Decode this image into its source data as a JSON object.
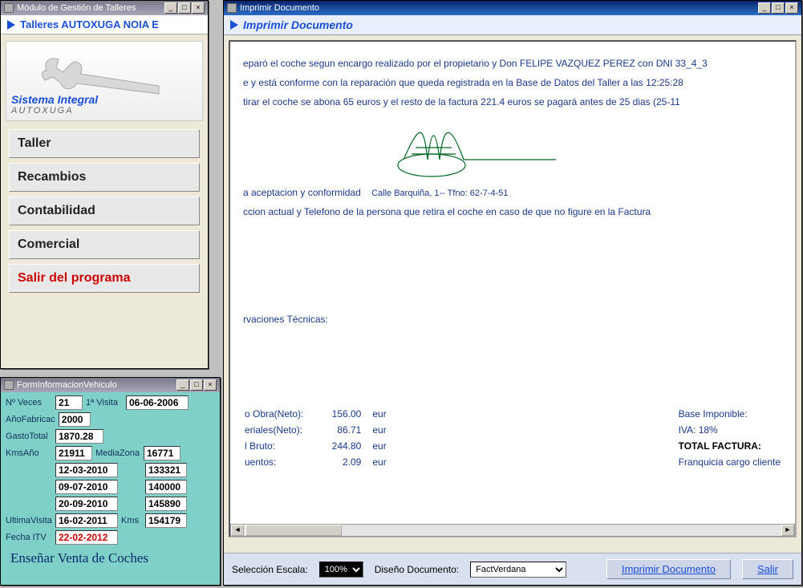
{
  "w1": {
    "title": "Módulo de Gestión de Talleres",
    "header": "Talleres AUTOXUGA NOIA E",
    "logo_line1": "Sistema Integral",
    "logo_line2": "AUTOXUGA",
    "nav": {
      "taller": "Taller",
      "recambios": "Recambios",
      "contabilidad": "Contabilidad",
      "comercial": "Comercial",
      "salir": "Salir del programa"
    }
  },
  "w2": {
    "title": "FormInformacionVehiculo",
    "labels": {
      "nveces": "Nº Veces",
      "primera": "1ª Visita",
      "anofab": "AñoFabricac",
      "gasto": "GastoTotal",
      "kmsano": "KmsAño",
      "media": "MediaZona",
      "ultvisita": "UltimaVisita",
      "kms": "Kms",
      "itv": "Fecha ITV"
    },
    "values": {
      "nveces": "21",
      "primera": "06-06-2006",
      "anofab": "2000",
      "gasto": "1870.28",
      "kmsano": "21911",
      "media": "16771",
      "hist": [
        {
          "date": "12-03-2010",
          "km": "133321"
        },
        {
          "date": "09-07-2010",
          "km": "140000"
        },
        {
          "date": "20-09-2010",
          "km": "145890"
        }
      ],
      "ultvisita": "16-02-2011",
      "kms": "154179",
      "itv": "22-02-2012"
    },
    "bottomlink": "Enseñar Venta de Coches"
  },
  "w3": {
    "title": "Imprimir Documento",
    "header": "Imprimir Documento",
    "doc": {
      "p1": "eparó el coche segun encargo realizado por el propietario y Don FELIPE VAZQUEZ PEREZ con DNI 33_4_3",
      "p2": "e y está conforme con la reparación que queda registrada en la Base de Datos del Taller a las 12:25:28",
      "p3": "tirar el coche se abona 65 euros y el resto de la factura 221.4 euros se pagará antes de 25 dias (25-11",
      "conformidad": "a aceptacion y conformidad",
      "addr": "Calle Barquiña, 1-- Tfno: 62-7-4-51",
      "p4": "ccion actual y Telefono de la persona que retira el coche en caso de que no figure en la Factura",
      "tech": "rvaciones Técnicas:",
      "leftrows": [
        {
          "label": "o Obra(Neto):",
          "val": "156.00",
          "cur": "eur"
        },
        {
          "label": "eriales(Neto):",
          "val": "86.71",
          "cur": "eur"
        },
        {
          "label": "l Bruto:",
          "val": "244.80",
          "cur": "eur"
        },
        {
          "label": "uentos:",
          "val": "2.09",
          "cur": "eur"
        }
      ],
      "rightrows": [
        {
          "label": "Base Imponible:",
          "bold": false
        },
        {
          "label": "IVA:   18%",
          "bold": false
        },
        {
          "label": "TOTAL FACTURA:",
          "bold": true
        },
        {
          "label": "Franquicia cargo cliente",
          "bold": false
        }
      ]
    },
    "bottombar": {
      "escala_lbl": "Selección Escala:",
      "escala_val": "100%",
      "diseno_lbl": "Diseño Documento:",
      "diseno_val": "FactVerdana",
      "imprimir": "Imprimir Documento",
      "salir": "Salir"
    }
  }
}
